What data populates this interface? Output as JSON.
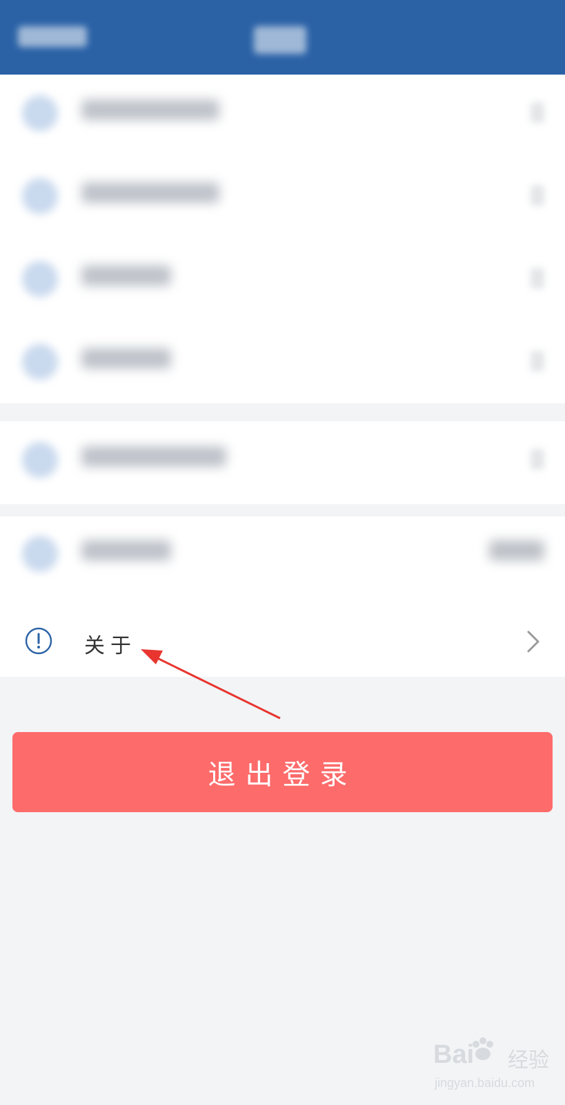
{
  "header": {
    "back_label": "",
    "title": "",
    "bg_color": "#2b62a6"
  },
  "about": {
    "label": "关于",
    "icon": "info-circle-icon",
    "icon_color": "#2b62a6"
  },
  "logout": {
    "label": "退出登录",
    "color": "#fd6b6b"
  },
  "watermark": {
    "brand": "Bai",
    "brand_suffix": "经验",
    "url": "jingyan.baidu.com"
  }
}
